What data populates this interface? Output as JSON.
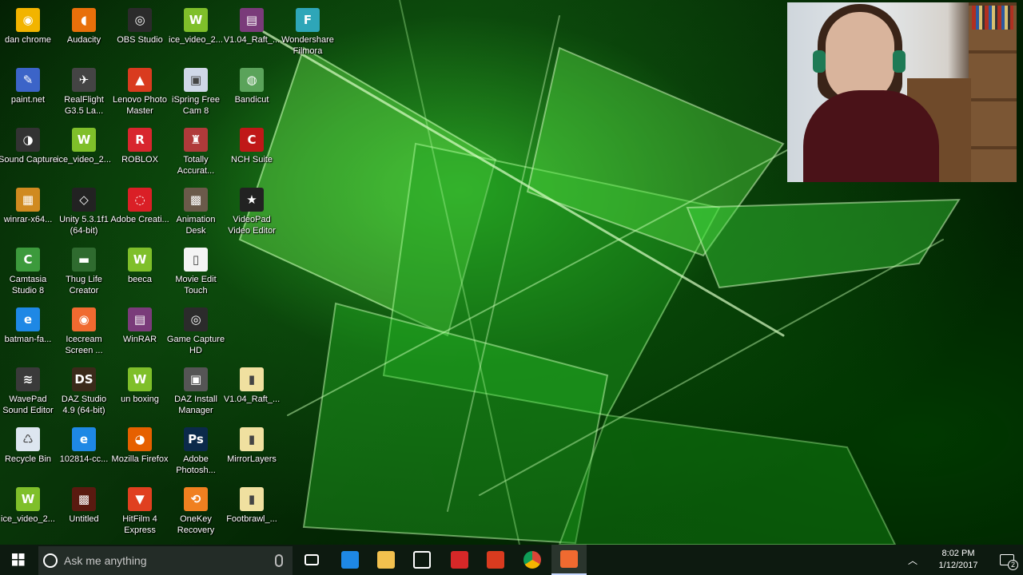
{
  "desktop": {
    "icons": [
      {
        "label": "dan chrome",
        "icon": "chrome-icon",
        "color": "#f2b400",
        "glyph": "◉"
      },
      {
        "label": "Audacity",
        "icon": "audacity-icon",
        "color": "#e8700a",
        "glyph": "◖"
      },
      {
        "label": "OBS Studio",
        "icon": "obs-icon",
        "color": "#2b2b2b",
        "glyph": "◎"
      },
      {
        "label": "ice_video_2...",
        "icon": "video-file-icon",
        "color": "#7fbf2a",
        "glyph": "W"
      },
      {
        "label": "V1.04_Raft_...",
        "icon": "winrar-archive-icon",
        "color": "#7a3b7a",
        "glyph": "▤"
      },
      {
        "label": "Wondershare Filmora",
        "icon": "filmora-icon",
        "color": "#2ea6b8",
        "glyph": "F"
      },
      {
        "label": "paint.net",
        "icon": "paintnet-icon",
        "color": "#3c64c8",
        "glyph": "✎"
      },
      {
        "label": "RealFlight G3.5 La...",
        "icon": "realflight-icon",
        "color": "#444444",
        "glyph": "✈"
      },
      {
        "label": "Lenovo Photo Master",
        "icon": "lenovo-photo-icon",
        "color": "#d93b1f",
        "glyph": "▲"
      },
      {
        "label": "iSpring Free Cam 8",
        "icon": "ispring-icon",
        "color": "#d0d8e8",
        "glyph": "▣"
      },
      {
        "label": "Bandicut",
        "icon": "bandicut-icon",
        "color": "#5aa35a",
        "glyph": "◍"
      },
      {
        "label": "Sound Capture",
        "icon": "sound-capture-icon",
        "color": "#333333",
        "glyph": "◑"
      },
      {
        "label": "ice_video_2...",
        "icon": "video-file-icon",
        "color": "#7fbf2a",
        "glyph": "W"
      },
      {
        "label": "ROBLOX",
        "icon": "roblox-icon",
        "color": "#d8262e",
        "glyph": "R"
      },
      {
        "label": "Totally Accurat...",
        "icon": "tabs-icon",
        "color": "#b03a3a",
        "glyph": "♜"
      },
      {
        "label": "NCH Suite",
        "icon": "nch-icon",
        "color": "#c01818",
        "glyph": "C"
      },
      {
        "label": "winrar-x64...",
        "icon": "winrar-installer-icon",
        "color": "#d08a20",
        "glyph": "▦"
      },
      {
        "label": "Unity 5.3.1f1 (64-bit)",
        "icon": "unity-icon",
        "color": "#222222",
        "glyph": "◇"
      },
      {
        "label": "Adobe Creati...",
        "icon": "adobe-cc-icon",
        "color": "#da1f26",
        "glyph": "◌"
      },
      {
        "label": "Animation Desk",
        "icon": "animation-desk-icon",
        "color": "#6b5a4a",
        "glyph": "▩"
      },
      {
        "label": "VideoPad Video Editor",
        "icon": "videopad-icon",
        "color": "#222222",
        "glyph": "★"
      },
      {
        "label": "Camtasia Studio 8",
        "icon": "camtasia-icon",
        "color": "#3c9a3c",
        "glyph": "C"
      },
      {
        "label": "Thug Life Creator",
        "icon": "thug-life-icon",
        "color": "#2f6b2f",
        "glyph": "▬"
      },
      {
        "label": "beeca",
        "icon": "video-file-icon",
        "color": "#7fbf2a",
        "glyph": "W"
      },
      {
        "label": "Movie Edit Touch",
        "icon": "document-icon",
        "color": "#f4f4f4",
        "glyph": "▯"
      },
      {
        "label": "batman-fa...",
        "icon": "ie-icon",
        "color": "#1e88e5",
        "glyph": "e"
      },
      {
        "label": "Icecream Screen ...",
        "icon": "icecream-icon",
        "color": "#f06a30",
        "glyph": "◉"
      },
      {
        "label": "WinRAR",
        "icon": "winrar-icon",
        "color": "#7a3b7a",
        "glyph": "▤"
      },
      {
        "label": "Game Capture HD",
        "icon": "game-capture-icon",
        "color": "#2b2b2b",
        "glyph": "◎"
      },
      {
        "label": "WavePad Sound Editor",
        "icon": "wavepad-icon",
        "color": "#3a3a3a",
        "glyph": "≋"
      },
      {
        "label": "DAZ Studio 4.9 (64-bit)",
        "icon": "daz-studio-icon",
        "color": "#3a2a1a",
        "glyph": "DS"
      },
      {
        "label": "un boxing",
        "icon": "video-file-icon",
        "color": "#7fbf2a",
        "glyph": "W"
      },
      {
        "label": "DAZ Install Manager",
        "icon": "daz-install-icon",
        "color": "#555555",
        "glyph": "▣"
      },
      {
        "label": "V1.04_Raft_...",
        "icon": "folder-zip-icon",
        "color": "#f0e0a0",
        "glyph": "▮"
      },
      {
        "label": "Recycle Bin",
        "icon": "recycle-bin-icon",
        "color": "#dde6f0",
        "glyph": "♺"
      },
      {
        "label": "102814-cc...",
        "icon": "ie-icon",
        "color": "#1e88e5",
        "glyph": "e"
      },
      {
        "label": "Mozilla Firefox",
        "icon": "firefox-icon",
        "color": "#e66000",
        "glyph": "◕"
      },
      {
        "label": "Adobe Photosh...",
        "icon": "photoshop-icon",
        "color": "#0b2a4a",
        "glyph": "Ps"
      },
      {
        "label": "MirrorLayers",
        "icon": "folder-zip-icon",
        "color": "#f0e0a0",
        "glyph": "▮"
      },
      {
        "label": "ice_video_2...",
        "icon": "video-file-icon",
        "color": "#7fbf2a",
        "glyph": "W"
      },
      {
        "label": "Untitled",
        "icon": "image-file-icon",
        "color": "#5a1a10",
        "glyph": "▩"
      },
      {
        "label": "HitFilm 4 Express",
        "icon": "hitfilm-icon",
        "color": "#e04020",
        "glyph": "▼"
      },
      {
        "label": "OneKey Recovery",
        "icon": "onekey-icon",
        "color": "#f08020",
        "glyph": "⟲"
      },
      {
        "label": "Footbrawl_...",
        "icon": "folder-zip-icon",
        "color": "#f0e0a0",
        "glyph": "▮"
      }
    ]
  },
  "webcam": {
    "label": "webcam-overlay"
  },
  "taskbar": {
    "search_placeholder": "Ask me anything",
    "apps": [
      {
        "name": "task-view",
        "color": "#ffffff"
      },
      {
        "name": "edge",
        "color": "#1e88e5"
      },
      {
        "name": "file-explorer",
        "color": "#f2c14e"
      },
      {
        "name": "store",
        "color": "#ffffff"
      },
      {
        "name": "video-app",
        "color": "#d62828"
      },
      {
        "name": "lenovo-photo",
        "color": "#d93b1f"
      },
      {
        "name": "chrome",
        "color": "#f2b400"
      },
      {
        "name": "icecream-recorder",
        "color": "#f06a30"
      }
    ],
    "clock_time": "8:02 PM",
    "clock_date": "1/12/2017",
    "notification_count": "2"
  }
}
